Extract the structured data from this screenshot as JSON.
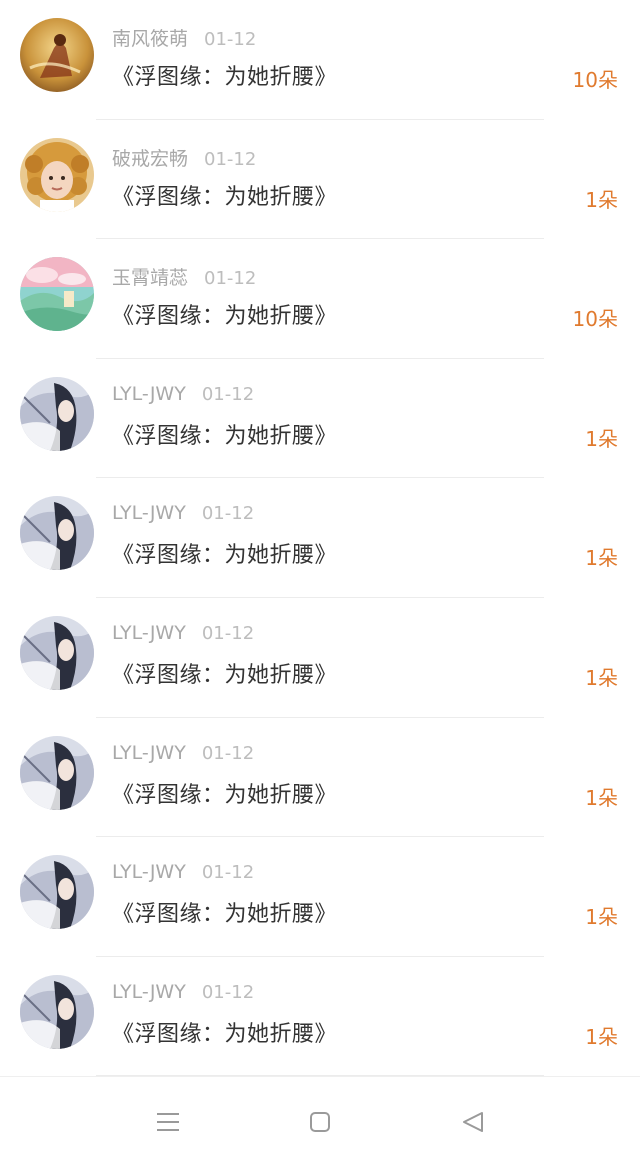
{
  "rows": [
    {
      "name": "南风筱萌",
      "date": "01-12",
      "title": "《浮图缘：为她折腰》",
      "amount": "10朵",
      "avatar_icon": "golden-warrior-avatar"
    },
    {
      "name": "破戒宏畅",
      "date": "01-12",
      "title": "《浮图缘：为她折腰》",
      "amount": "1朵",
      "avatar_icon": "curly-hair-child-avatar"
    },
    {
      "name": "玉霄靖蕊",
      "date": "01-12",
      "title": "《浮图缘：为她折腰》",
      "amount": "10朵",
      "avatar_icon": "landscape-avatar"
    },
    {
      "name": "LYL-JWY",
      "date": "01-12",
      "title": "《浮图缘：为她折腰》",
      "amount": "1朵",
      "avatar_icon": "anime-character-avatar"
    },
    {
      "name": "LYL-JWY",
      "date": "01-12",
      "title": "《浮图缘：为她折腰》",
      "amount": "1朵",
      "avatar_icon": "anime-character-avatar"
    },
    {
      "name": "LYL-JWY",
      "date": "01-12",
      "title": "《浮图缘：为她折腰》",
      "amount": "1朵",
      "avatar_icon": "anime-character-avatar"
    },
    {
      "name": "LYL-JWY",
      "date": "01-12",
      "title": "《浮图缘：为她折腰》",
      "amount": "1朵",
      "avatar_icon": "anime-character-avatar"
    },
    {
      "name": "LYL-JWY",
      "date": "01-12",
      "title": "《浮图缘：为她折腰》",
      "amount": "1朵",
      "avatar_icon": "anime-character-avatar"
    },
    {
      "name": "LYL-JWY",
      "date": "01-12",
      "title": "《浮图缘：为她折腰》",
      "amount": "1朵",
      "avatar_icon": "anime-character-avatar"
    }
  ],
  "navbar": {
    "menu_icon": "menu-icon",
    "home_icon": "home-square-icon",
    "back_icon": "back-triangle-icon"
  },
  "colors": {
    "amount": "#e07a2e",
    "name": "#a8a8a8",
    "title": "#333333"
  }
}
